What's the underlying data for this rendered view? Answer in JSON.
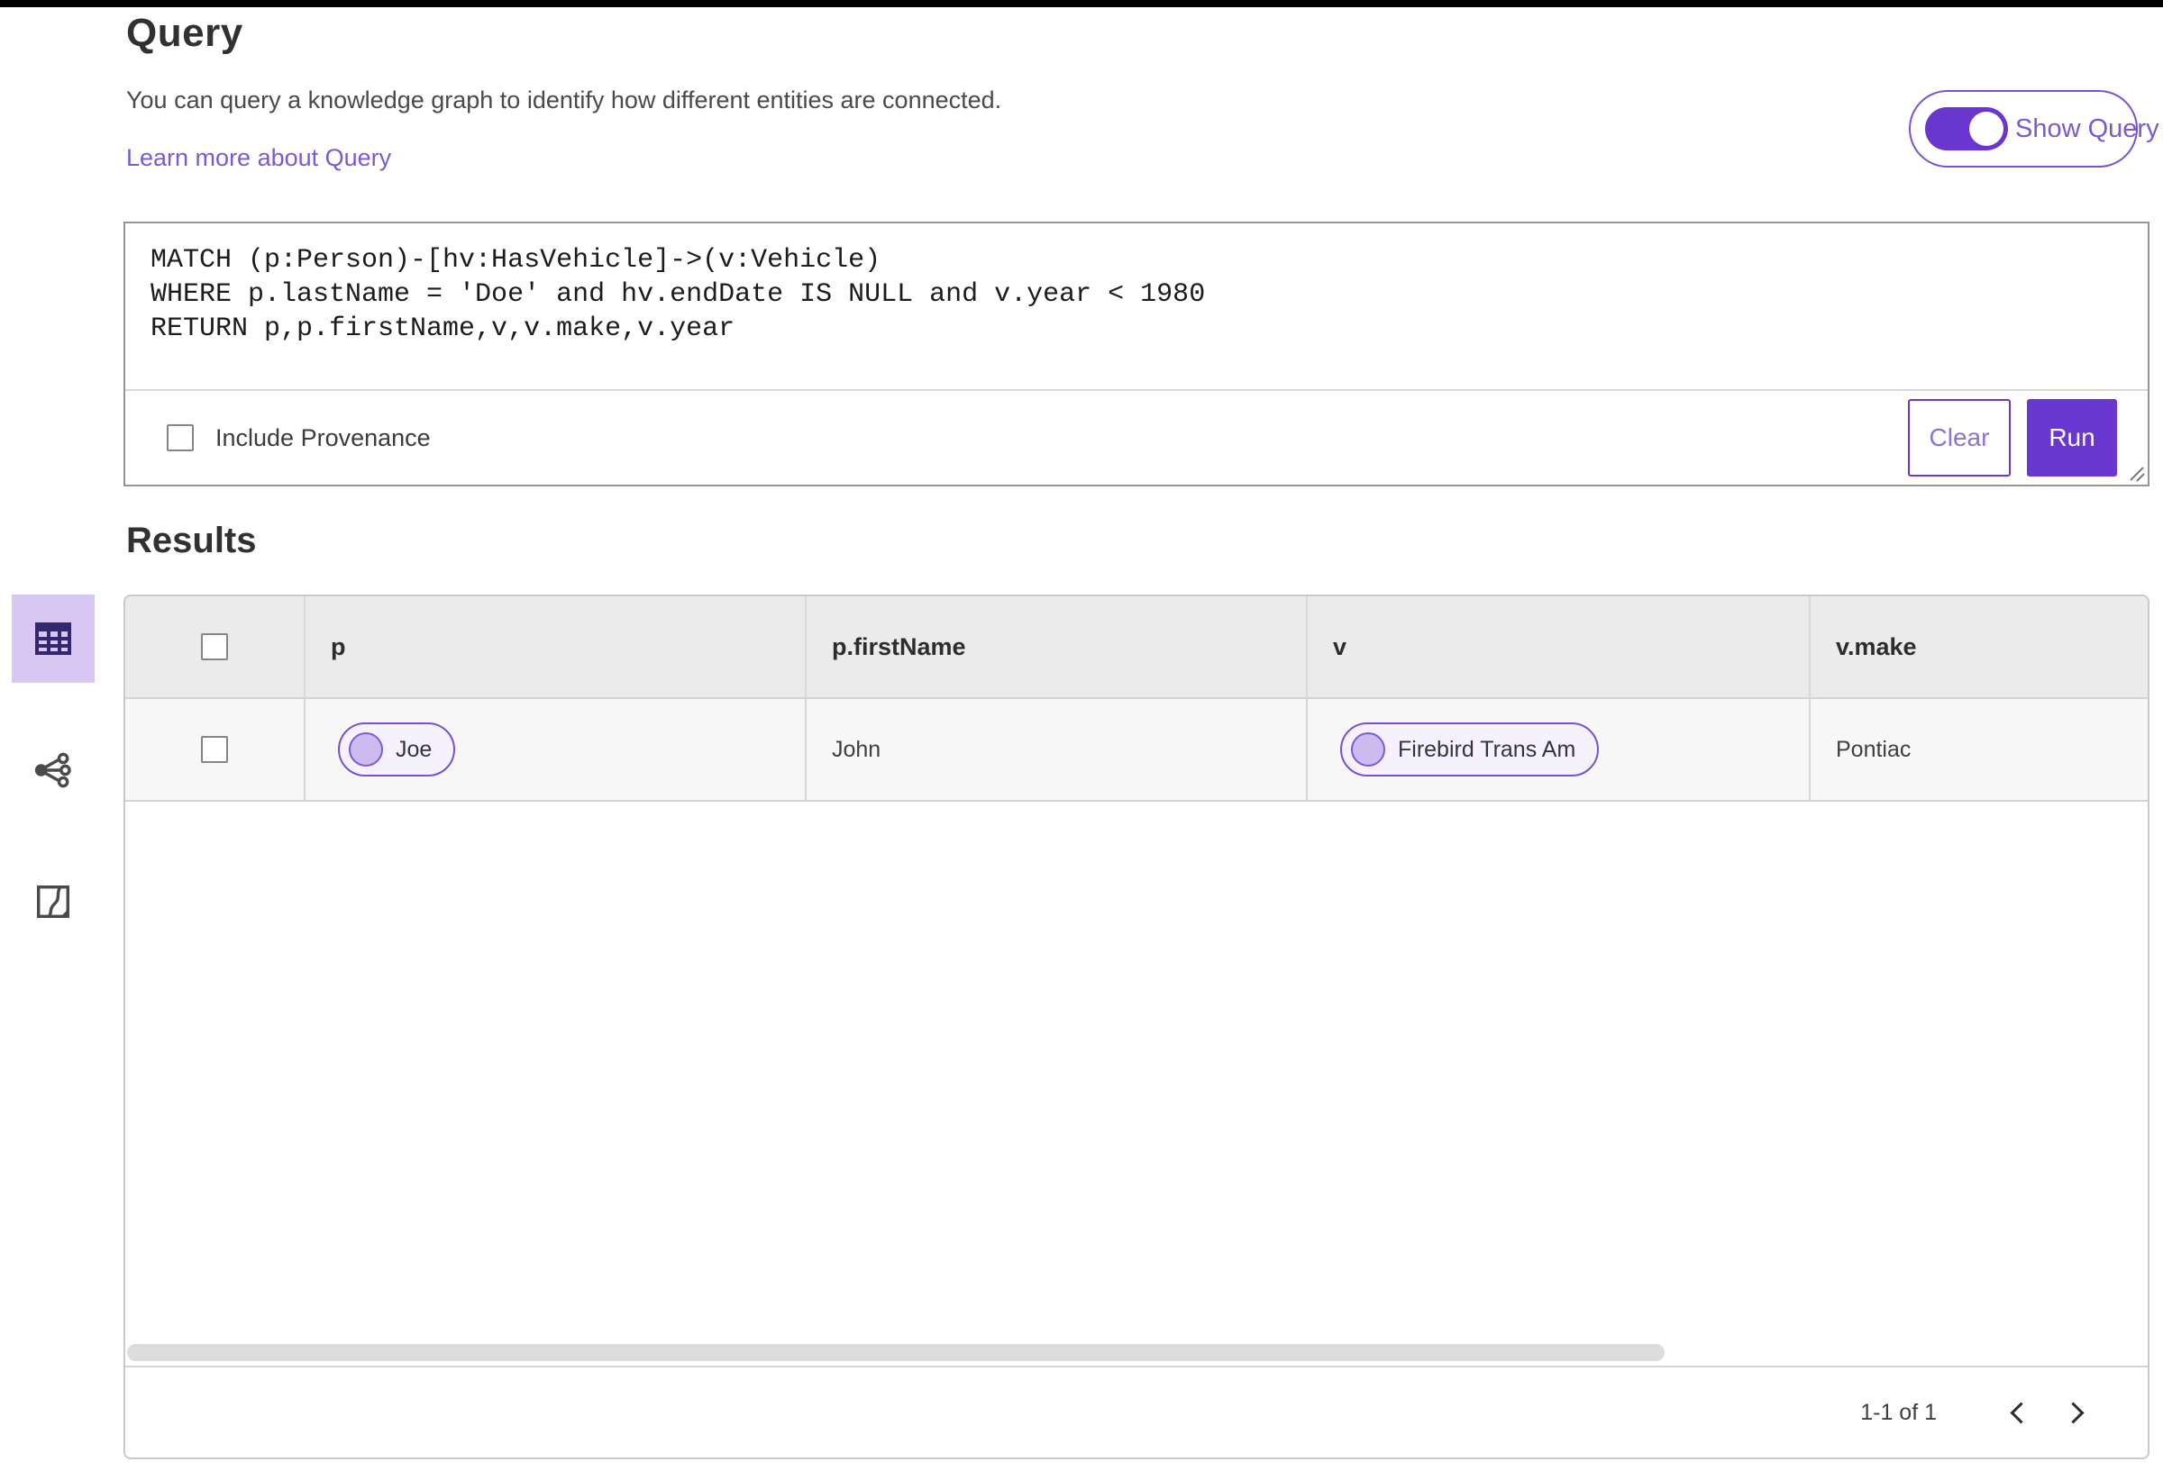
{
  "header": {
    "title": "Query",
    "description": "You can query a knowledge graph to identify how different entities are connected.",
    "learn_more_link": "Learn more about Query",
    "show_query_toggle": {
      "label": "Show Query",
      "state": "on"
    }
  },
  "query_editor": {
    "code": "MATCH (p:Person)-[hv:HasVehicle]->(v:Vehicle)\nWHERE p.lastName = 'Doe' and hv.endDate IS NULL and v.year < 1980\nRETURN p,p.firstName,v,v.make,v.year",
    "include_provenance_label": "Include Provenance",
    "include_provenance_checked": false,
    "clear_button_label": "Clear",
    "run_button_label": "Run"
  },
  "results": {
    "heading": "Results",
    "view_switcher": [
      {
        "icon": "table-view-icon",
        "selected": true
      },
      {
        "icon": "graph-view-icon",
        "selected": false
      },
      {
        "icon": "map-view-icon",
        "selected": false
      }
    ],
    "table": {
      "headers": [
        "p",
        "p.firstName",
        "v",
        "v.make"
      ],
      "rows": [
        {
          "p_chip": "Joe",
          "firstName": "John",
          "v_chip": "Firebird Trans Am",
          "make": "Pontiac"
        }
      ],
      "row_count_visible": 1
    },
    "pagination": {
      "range_label": "1-1 of 1"
    }
  },
  "colors": {
    "accent_purple": "#6a36d0",
    "link_purple": "#7a5ad2",
    "chip_border": "#7a4fd2",
    "chip_fill": "#f6f2fd",
    "chip_dot_fill": "#cdbaee",
    "selected_view_bg": "#d9c7f3",
    "table_header_bg": "#ebebeb",
    "table_row_bg": "#f7f7f7",
    "panel_border": "#949494",
    "grid_border": "#d4d4d4"
  }
}
